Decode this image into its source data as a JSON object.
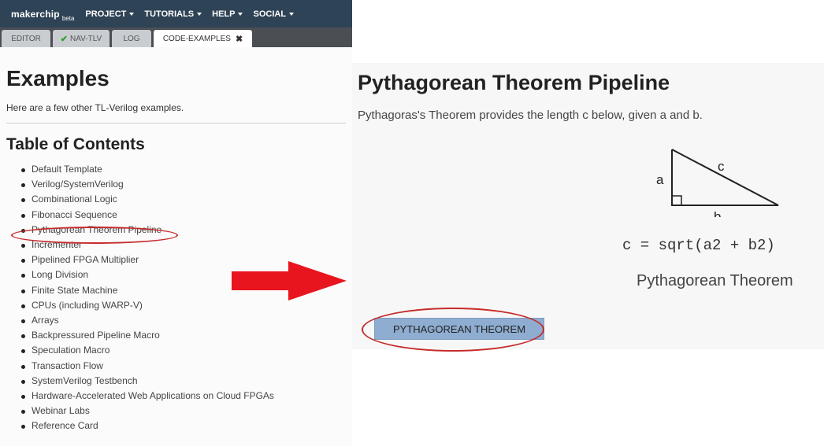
{
  "app": {
    "logo_main": "makerchip",
    "logo_beta": "beta",
    "menu": [
      {
        "label": "PROJECT"
      },
      {
        "label": "TUTORIALS"
      },
      {
        "label": "HELP"
      },
      {
        "label": "SOCIAL"
      }
    ],
    "tabs": [
      {
        "label": "EDITOR"
      },
      {
        "label": "NAV-TLV"
      },
      {
        "label": "LOG"
      },
      {
        "label": "CODE-EXAMPLES"
      }
    ],
    "close_glyph": "✖",
    "check_glyph": "✔"
  },
  "examples": {
    "title": "Examples",
    "intro": "Here are a few other TL-Verilog examples.",
    "toc_title": "Table of Contents",
    "toc": [
      "Default Template",
      "Verilog/SystemVerilog",
      "Combinational Logic",
      "Fibonacci Sequence",
      "Pythagorean Theorem Pipeline",
      "Incrementer",
      "Pipelined FPGA Multiplier",
      "Long Division",
      "Finite State Machine",
      "CPUs (including WARP-V)",
      "Arrays",
      "Backpressured Pipeline Macro",
      "Speculation Macro",
      "Transaction Flow",
      "SystemVerilog Testbench",
      "Hardware-Accelerated Web Applications on Cloud FPGAs",
      "Webinar Labs",
      "Reference Card"
    ]
  },
  "detail": {
    "title": "Pythagorean Theorem Pipeline",
    "description": "Pythagoras's Theorem provides the length c below, given a and b.",
    "label_a": "a",
    "label_b": "b",
    "label_c": "c",
    "formula": "c = sqrt(a2 + b2)",
    "caption": "Pythagorean Theorem",
    "button_label": "PYTHAGOREAN THEOREM"
  },
  "colors": {
    "topbar": "#2f4356",
    "highlight": "#c62b2b",
    "arrow": "#e8141e",
    "button": "#8eadd0"
  }
}
